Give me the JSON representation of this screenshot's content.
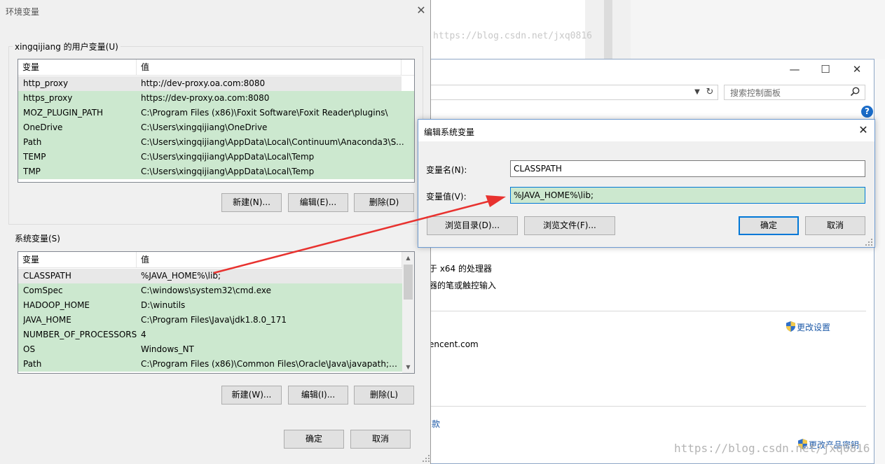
{
  "background_window": {
    "watermark_top": "https://blog.csdn.net/jxq0816",
    "search_placeholder": "搜索控制面板",
    "processor_text": "于 x64 的处理器",
    "pen_touch_text": "器的笔或触控输入",
    "domain_text": "encent.com",
    "change_settings_link": "更改设置",
    "terms_link": "款",
    "change_product_key_link": "更改产品密钥",
    "watermark_bottom": "https://blog.csdn.net/jxq0816",
    "controls": {
      "minimize": "—",
      "maximize": "☐",
      "close": "✕"
    }
  },
  "env_dialog": {
    "title": "环境变量",
    "close": "✕",
    "user_vars": {
      "title": "xingqijiang 的用户变量(U)",
      "headers": [
        "变量",
        "值"
      ],
      "rows": [
        {
          "name": "http_proxy",
          "value": "http://dev-proxy.oa.com:8080"
        },
        {
          "name": "https_proxy",
          "value": "https://dev-proxy.oa.com:8080"
        },
        {
          "name": "MOZ_PLUGIN_PATH",
          "value": "C:\\Program Files (x86)\\Foxit Software\\Foxit Reader\\plugins\\"
        },
        {
          "name": "OneDrive",
          "value": "C:\\Users\\xingqijiang\\OneDrive"
        },
        {
          "name": "Path",
          "value": "C:\\Users\\xingqijiang\\AppData\\Local\\Continuum\\Anaconda3\\S..."
        },
        {
          "name": "TEMP",
          "value": "C:\\Users\\xingqijiang\\AppData\\Local\\Temp"
        },
        {
          "name": "TMP",
          "value": "C:\\Users\\xingqijiang\\AppData\\Local\\Temp"
        }
      ],
      "buttons": {
        "new": "新建(N)...",
        "edit": "编辑(E)...",
        "delete": "删除(D)"
      }
    },
    "system_vars": {
      "title": "系统变量(S)",
      "headers": [
        "变量",
        "值"
      ],
      "rows": [
        {
          "name": "CLASSPATH",
          "value": "%JAVA_HOME%\\lib;"
        },
        {
          "name": "ComSpec",
          "value": "C:\\windows\\system32\\cmd.exe"
        },
        {
          "name": "HADOOP_HOME",
          "value": "D:\\winutils"
        },
        {
          "name": "JAVA_HOME",
          "value": "C:\\Program Files\\Java\\jdk1.8.0_171"
        },
        {
          "name": "NUMBER_OF_PROCESSORS",
          "value": "4"
        },
        {
          "name": "OS",
          "value": "Windows_NT"
        },
        {
          "name": "Path",
          "value": "C:\\Program Files (x86)\\Common Files\\Oracle\\Java\\javapath;C:..."
        }
      ],
      "buttons": {
        "new": "新建(W)...",
        "edit": "编辑(I)...",
        "delete": "删除(L)"
      }
    },
    "ok": "确定",
    "cancel": "取消"
  },
  "edit_dialog": {
    "title": "编辑系统变量",
    "close": "✕",
    "name_label": "变量名(N):",
    "name_value": "CLASSPATH",
    "value_label": "变量值(V):",
    "value_value": "%JAVA_HOME%\\lib;",
    "browse_dir": "浏览目录(D)...",
    "browse_file": "浏览文件(F)...",
    "ok": "确定",
    "cancel": "取消"
  },
  "colors": {
    "row_green": "#cce8cf",
    "selected_row": "#e8e8e8",
    "focus_blue": "#0078d7",
    "annotation_arrow": "#e8322f",
    "link_blue": "#1e5aa8"
  },
  "icons": [
    "search-icon",
    "help-icon",
    "shield-icon",
    "chevron-down-icon",
    "refresh-icon",
    "close-icon",
    "resize-grip-icon"
  ]
}
